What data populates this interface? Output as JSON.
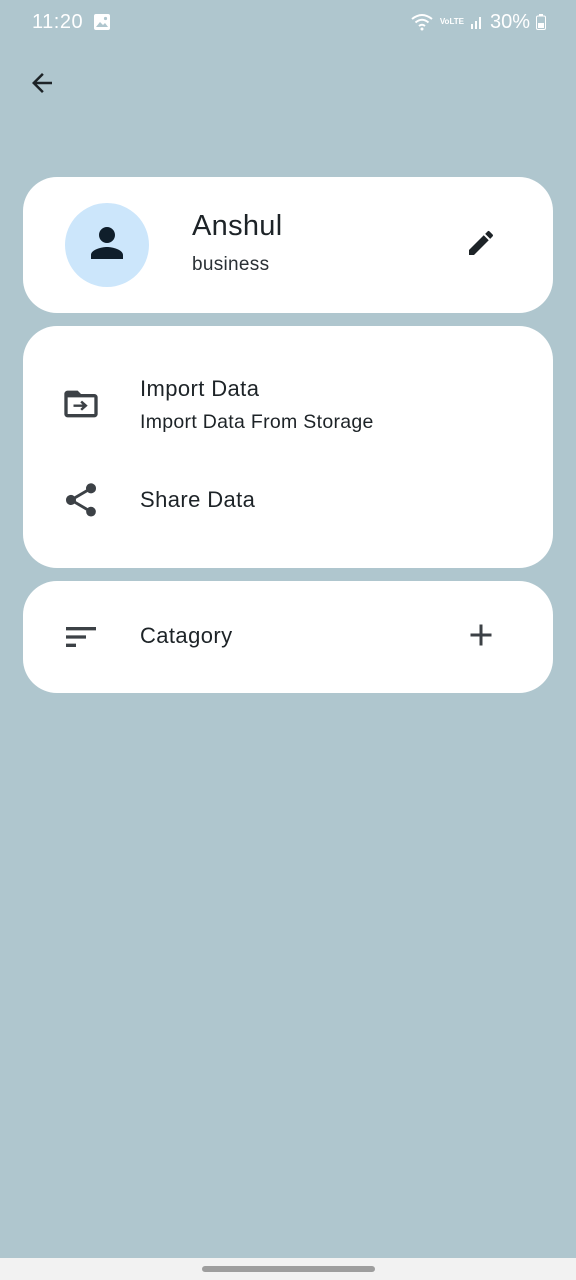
{
  "status_bar": {
    "time": "11:20",
    "battery": "30%",
    "network": "VoLTE"
  },
  "profile": {
    "name": "Anshul",
    "type": "business"
  },
  "data_actions": {
    "import_title": "Import Data",
    "import_subtitle": "Import Data From Storage",
    "share_title": "Share Data"
  },
  "category": {
    "label": "Catagory"
  },
  "icons": {
    "back": "arrow-back-icon",
    "avatar": "person-icon",
    "edit": "pencil-icon",
    "import": "folder-import-icon",
    "share": "share-icon",
    "category": "sort-lines-icon",
    "add": "plus-icon"
  },
  "colors": {
    "background": "#afc6ce",
    "card": "#ffffff",
    "avatar_bg": "#cce6fb",
    "avatar_fg": "#0f1e2b",
    "icon": "#3c4146"
  }
}
